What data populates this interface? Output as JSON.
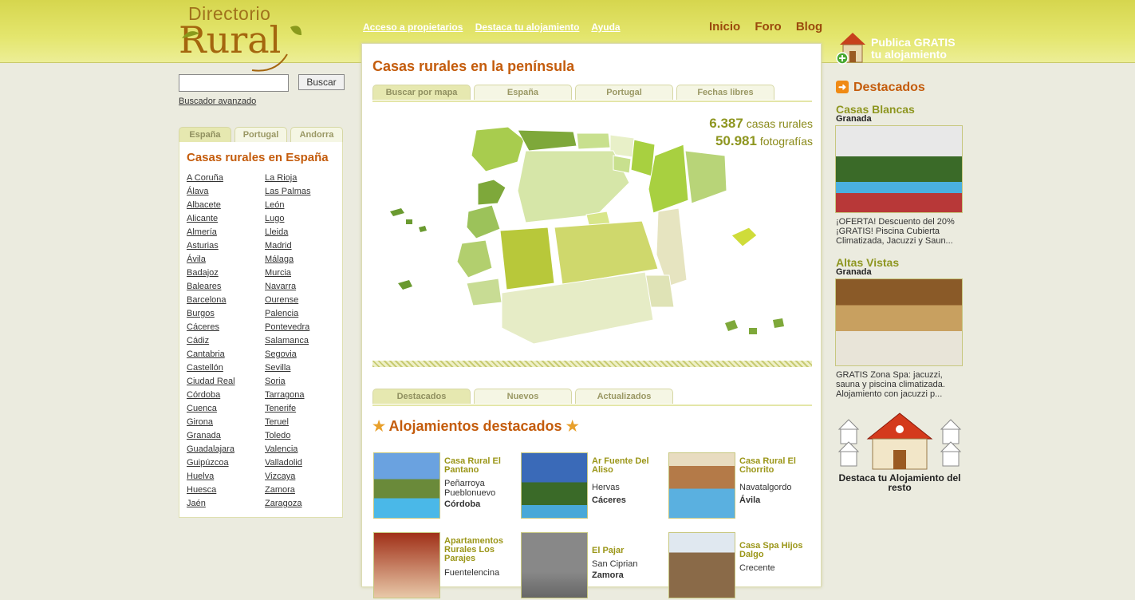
{
  "header": {
    "logo_top": "Directorio",
    "logo_main": "Rural",
    "top_links": [
      "Acceso a propietarios",
      "Destaca tu alojamiento",
      "Ayuda"
    ],
    "nav": [
      "Inicio",
      "Foro",
      "Blog"
    ],
    "publica_line1": "Publica GRATIS",
    "publica_line2": "tu alojamiento"
  },
  "search": {
    "value": "",
    "button": "Buscar",
    "advanced": "Buscador avanzado"
  },
  "left_tabs": [
    "España",
    "Portugal",
    "Andorra"
  ],
  "left_title": "Casas rurales en España",
  "provinces_col1": [
    "A Coruña",
    "Álava",
    "Albacete",
    "Alicante",
    "Almería",
    "Asturias",
    "Ávila",
    "Badajoz",
    "Baleares",
    "Barcelona",
    "Burgos",
    "Cáceres",
    "Cádiz",
    "Cantabria",
    "Castellón",
    "Ciudad Real",
    "Córdoba",
    "Cuenca",
    "Girona",
    "Granada",
    "Guadalajara",
    "Guipúzcoa",
    "Huelva",
    "Huesca",
    "Jaén"
  ],
  "provinces_col2": [
    "La Rioja",
    "Las Palmas",
    "León",
    "Lugo",
    "Lleida",
    "Madrid",
    "Málaga",
    "Murcia",
    "Navarra",
    "Ourense",
    "Palencia",
    "Pontevedra",
    "Salamanca",
    "Segovia",
    "Sevilla",
    "Soria",
    "Tarragona",
    "Tenerife",
    "Teruel",
    "Toledo",
    "Valencia",
    "Valladolid",
    "Vizcaya",
    "Zamora",
    "Zaragoza"
  ],
  "center": {
    "title": "Casas rurales en la península",
    "tabs": [
      "Buscar por mapa",
      "España",
      "Portugal",
      "Fechas libres"
    ],
    "stat_houses_num": "6.387",
    "stat_houses_label": "casas rurales",
    "stat_photos_num": "50.981",
    "stat_photos_label": "fotografías",
    "bottom_tabs": [
      "Destacados",
      "Nuevos",
      "Actualizados"
    ],
    "featured_title": "Alojamientos destacados"
  },
  "cards": [
    {
      "name": "Casa Rural El Pantano",
      "location": "Peñarroya Pueblonuevo",
      "province": "Córdoba"
    },
    {
      "name": "Ar Fuente Del Aliso",
      "location": "Hervas",
      "province": "Cáceres"
    },
    {
      "name": "Casa Rural El Chorrito",
      "location": "Navatalgordo",
      "province": "Ávila"
    },
    {
      "name": "Apartamentos Rurales Los Parajes",
      "location": "Fuentelencina",
      "province": ""
    },
    {
      "name": "El Pajar",
      "location": "San Ciprian",
      "province": "Zamora"
    },
    {
      "name": "Casa Spa Hijos Dalgo",
      "location": "Crecente",
      "province": ""
    }
  ],
  "right": {
    "heading": "Destacados",
    "featured": [
      {
        "title": "Casas Blancas",
        "city": "Granada",
        "desc": "¡OFERTA! Descuento del 20% ¡GRATIS! Piscina Cubierta Climatizada, Jacuzzi y Saun..."
      },
      {
        "title": "Altas Vistas",
        "city": "Granada",
        "desc": "GRATIS Zona Spa: jacuzzi, sauna y piscina climatizada. Alojamiento con jacuzzi p..."
      }
    ],
    "destaca_text": "Destaca tu Alojamiento del resto"
  },
  "icons": [
    "house-icon",
    "arrow-right-icon",
    "star-icon",
    "houses-icon"
  ]
}
